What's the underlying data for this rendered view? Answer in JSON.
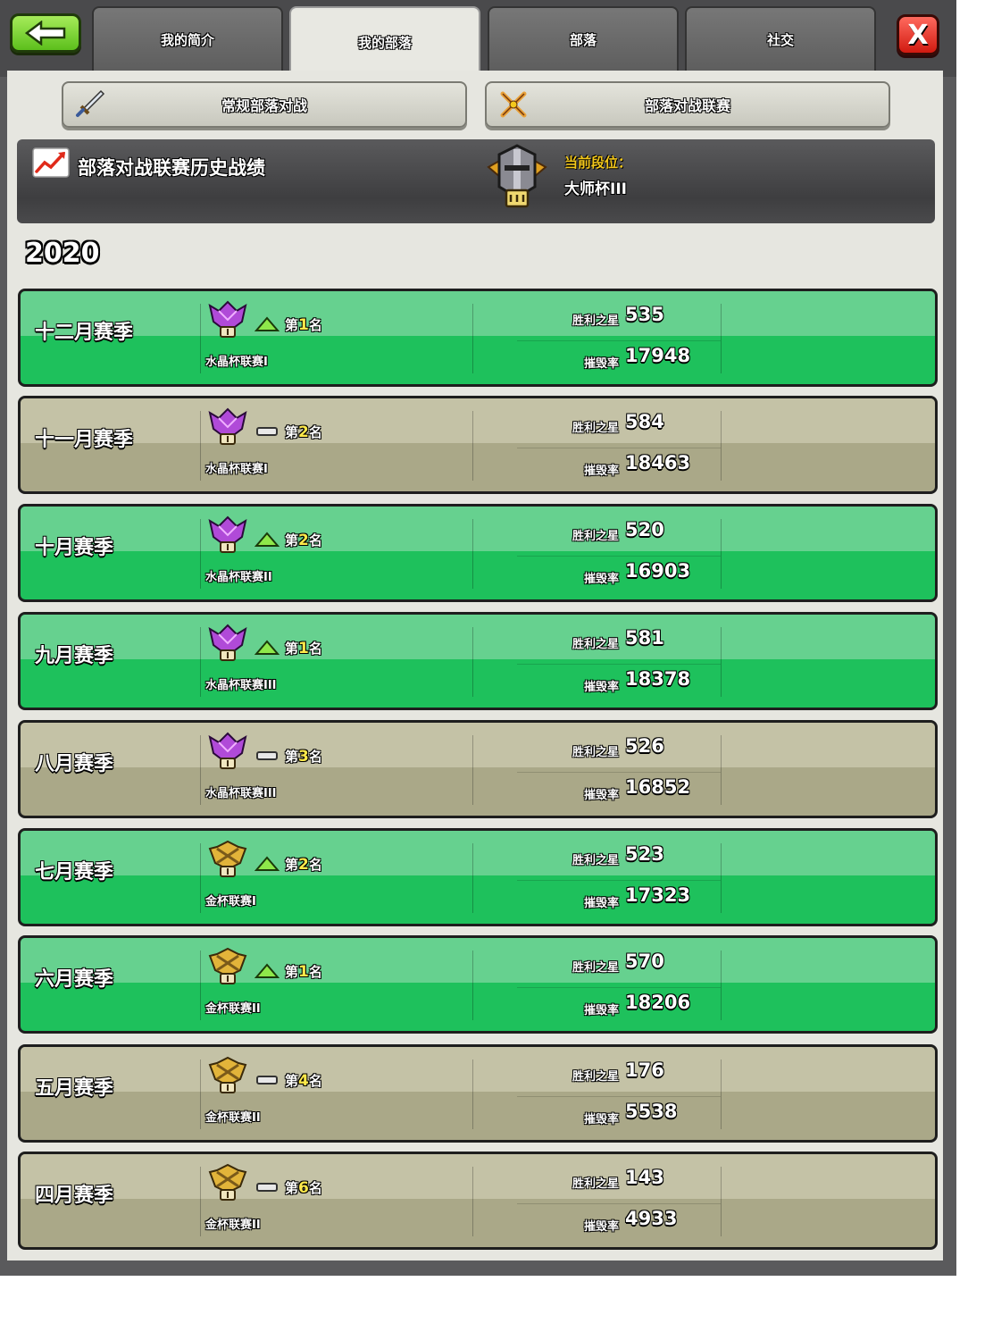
{
  "tabs": [
    "我的简介",
    "我的部落",
    "部落",
    "社交"
  ],
  "active_tab": 1,
  "close_label": "X",
  "sub_buttons": {
    "regular": "常规部落对战",
    "league": "部落对战联赛"
  },
  "history": {
    "title": "部落对战联赛历史战绩",
    "current_label": "当前段位：",
    "current_value": "大师杯III"
  },
  "year": "2020",
  "labels": {
    "stars": "胜利之星",
    "destruction": "摧毁率",
    "rank_prefix": "第",
    "rank_suffix": "名"
  },
  "seasons": [
    {
      "name": "十二月赛季",
      "trend": "up",
      "rank": "1",
      "league": "水晶杯联赛I",
      "badge": "crystal",
      "stars": "535",
      "destruction": "17948"
    },
    {
      "name": "十一月赛季",
      "trend": "same",
      "rank": "2",
      "league": "水晶杯联赛I",
      "badge": "crystal",
      "stars": "584",
      "destruction": "18463"
    },
    {
      "name": "十月赛季",
      "trend": "up",
      "rank": "2",
      "league": "水晶杯联赛II",
      "badge": "crystal",
      "stars": "520",
      "destruction": "16903"
    },
    {
      "name": "九月赛季",
      "trend": "up",
      "rank": "1",
      "league": "水晶杯联赛III",
      "badge": "crystal",
      "stars": "581",
      "destruction": "18378"
    },
    {
      "name": "八月赛季",
      "trend": "same",
      "rank": "3",
      "league": "水晶杯联赛III",
      "badge": "crystal",
      "stars": "526",
      "destruction": "16852"
    },
    {
      "name": "七月赛季",
      "trend": "up",
      "rank": "2",
      "league": "金杯联赛I",
      "badge": "gold",
      "stars": "523",
      "destruction": "17323"
    },
    {
      "name": "六月赛季",
      "trend": "up",
      "rank": "1",
      "league": "金杯联赛II",
      "badge": "gold",
      "stars": "570",
      "destruction": "18206"
    },
    {
      "name": "五月赛季",
      "trend": "same",
      "rank": "4",
      "league": "金杯联赛II",
      "badge": "gold",
      "stars": "176",
      "destruction": "5538"
    },
    {
      "name": "四月赛季",
      "trend": "same",
      "rank": "6",
      "league": "金杯联赛II",
      "badge": "gold",
      "stars": "143",
      "destruction": "4933"
    }
  ],
  "colors": {
    "promoted_row": "#1ec15c",
    "stayed_row": "#aaa888",
    "rank_number": "#ffe94a",
    "current_label": "#f4c81c"
  },
  "icons": {
    "back": "back-arrow-icon",
    "close": "close-icon",
    "regular_war": "sword-icon",
    "league_war": "crossed-swords-icon",
    "history": "chart-icon",
    "current_league": "master-league-badge-icon",
    "crystal": "crystal-league-badge-icon",
    "gold": "gold-league-badge-icon",
    "up": "promotion-arrow-icon",
    "same": "no-change-icon"
  }
}
